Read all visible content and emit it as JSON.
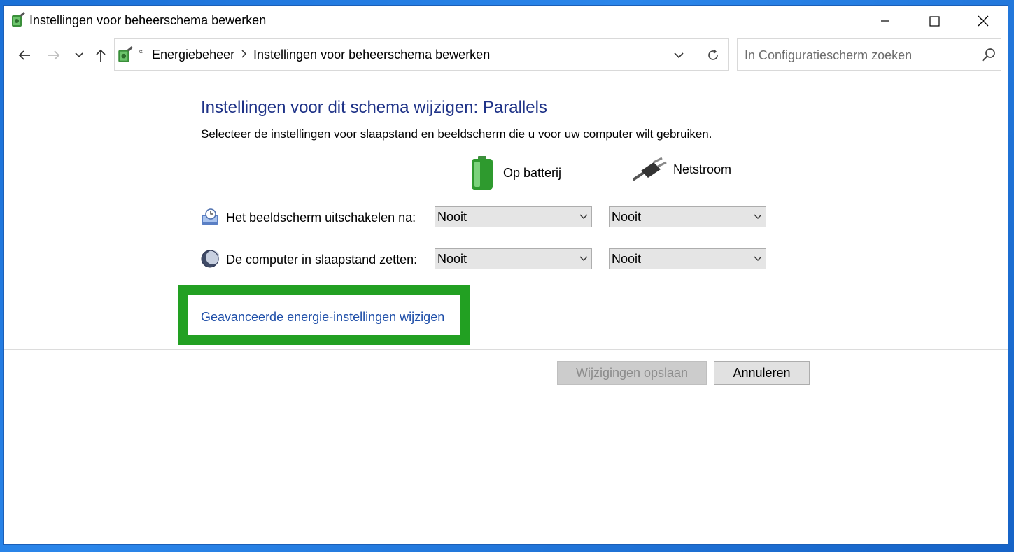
{
  "window": {
    "title": "Instellingen voor beheerschema bewerken"
  },
  "address_bar": {
    "breadcrumb": [
      "Energiebeheer",
      "Instellingen voor beheerschema bewerken"
    ],
    "overflow_glyph": "«"
  },
  "search": {
    "placeholder": "In Configuratiescherm zoeken"
  },
  "content": {
    "heading": "Instellingen voor dit schema wijzigen: Parallels",
    "description": "Selecteer de instellingen voor slaapstand en beeldscherm die u voor uw computer wilt gebruiken.",
    "columns": {
      "battery": "Op batterij",
      "ac": "Netstroom"
    },
    "rows": [
      {
        "label": "Het beeldscherm uitschakelen na:",
        "battery_value": "Nooit",
        "ac_value": "Nooit"
      },
      {
        "label": "De computer in slaapstand zetten:",
        "battery_value": "Nooit",
        "ac_value": "Nooit"
      }
    ],
    "advanced_link": "Geavanceerde energie-instellingen wijzigen"
  },
  "buttons": {
    "save": "Wijzigingen opslaan",
    "cancel": "Annuleren"
  },
  "colors": {
    "heading": "#1e3287",
    "link": "#1e4ea8",
    "highlight_border": "#22a022"
  }
}
